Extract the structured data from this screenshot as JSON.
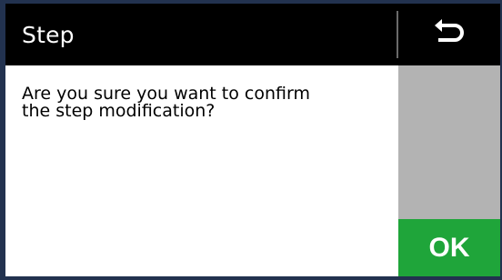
{
  "header": {
    "title": "Step",
    "back_icon": "back-return-icon"
  },
  "dialog": {
    "message_line1": "Are you sure you want to confirm",
    "message_line2": "the step modification?"
  },
  "actions": {
    "ok_label": "OK"
  },
  "colors": {
    "header_bg": "#000000",
    "side_panel": "#b3b3b3",
    "ok_button": "#1fa53a",
    "frame": "#22324f"
  }
}
